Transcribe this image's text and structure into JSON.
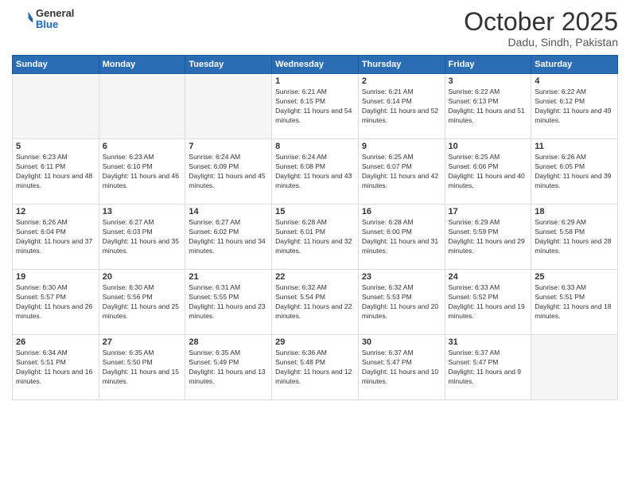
{
  "header": {
    "logo": {
      "general": "General",
      "blue": "Blue"
    },
    "title": "October 2025",
    "subtitle": "Dadu, Sindh, Pakistan"
  },
  "calendar": {
    "weekdays": [
      "Sunday",
      "Monday",
      "Tuesday",
      "Wednesday",
      "Thursday",
      "Friday",
      "Saturday"
    ],
    "weeks": [
      [
        {
          "day": "",
          "sunrise": "",
          "sunset": "",
          "daylight": "",
          "empty": true
        },
        {
          "day": "",
          "sunrise": "",
          "sunset": "",
          "daylight": "",
          "empty": true
        },
        {
          "day": "",
          "sunrise": "",
          "sunset": "",
          "daylight": "",
          "empty": true
        },
        {
          "day": "1",
          "sunrise": "Sunrise: 6:21 AM",
          "sunset": "Sunset: 6:15 PM",
          "daylight": "Daylight: 11 hours and 54 minutes."
        },
        {
          "day": "2",
          "sunrise": "Sunrise: 6:21 AM",
          "sunset": "Sunset: 6:14 PM",
          "daylight": "Daylight: 11 hours and 52 minutes."
        },
        {
          "day": "3",
          "sunrise": "Sunrise: 6:22 AM",
          "sunset": "Sunset: 6:13 PM",
          "daylight": "Daylight: 11 hours and 51 minutes."
        },
        {
          "day": "4",
          "sunrise": "Sunrise: 6:22 AM",
          "sunset": "Sunset: 6:12 PM",
          "daylight": "Daylight: 11 hours and 49 minutes."
        }
      ],
      [
        {
          "day": "5",
          "sunrise": "Sunrise: 6:23 AM",
          "sunset": "Sunset: 6:11 PM",
          "daylight": "Daylight: 11 hours and 48 minutes."
        },
        {
          "day": "6",
          "sunrise": "Sunrise: 6:23 AM",
          "sunset": "Sunset: 6:10 PM",
          "daylight": "Daylight: 11 hours and 46 minutes."
        },
        {
          "day": "7",
          "sunrise": "Sunrise: 6:24 AM",
          "sunset": "Sunset: 6:09 PM",
          "daylight": "Daylight: 11 hours and 45 minutes."
        },
        {
          "day": "8",
          "sunrise": "Sunrise: 6:24 AM",
          "sunset": "Sunset: 6:08 PM",
          "daylight": "Daylight: 11 hours and 43 minutes."
        },
        {
          "day": "9",
          "sunrise": "Sunrise: 6:25 AM",
          "sunset": "Sunset: 6:07 PM",
          "daylight": "Daylight: 11 hours and 42 minutes."
        },
        {
          "day": "10",
          "sunrise": "Sunrise: 6:25 AM",
          "sunset": "Sunset: 6:06 PM",
          "daylight": "Daylight: 11 hours and 40 minutes."
        },
        {
          "day": "11",
          "sunrise": "Sunrise: 6:26 AM",
          "sunset": "Sunset: 6:05 PM",
          "daylight": "Daylight: 11 hours and 39 minutes."
        }
      ],
      [
        {
          "day": "12",
          "sunrise": "Sunrise: 6:26 AM",
          "sunset": "Sunset: 6:04 PM",
          "daylight": "Daylight: 11 hours and 37 minutes."
        },
        {
          "day": "13",
          "sunrise": "Sunrise: 6:27 AM",
          "sunset": "Sunset: 6:03 PM",
          "daylight": "Daylight: 11 hours and 35 minutes."
        },
        {
          "day": "14",
          "sunrise": "Sunrise: 6:27 AM",
          "sunset": "Sunset: 6:02 PM",
          "daylight": "Daylight: 11 hours and 34 minutes."
        },
        {
          "day": "15",
          "sunrise": "Sunrise: 6:28 AM",
          "sunset": "Sunset: 6:01 PM",
          "daylight": "Daylight: 11 hours and 32 minutes."
        },
        {
          "day": "16",
          "sunrise": "Sunrise: 6:28 AM",
          "sunset": "Sunset: 6:00 PM",
          "daylight": "Daylight: 11 hours and 31 minutes."
        },
        {
          "day": "17",
          "sunrise": "Sunrise: 6:29 AM",
          "sunset": "Sunset: 5:59 PM",
          "daylight": "Daylight: 11 hours and 29 minutes."
        },
        {
          "day": "18",
          "sunrise": "Sunrise: 6:29 AM",
          "sunset": "Sunset: 5:58 PM",
          "daylight": "Daylight: 11 hours and 28 minutes."
        }
      ],
      [
        {
          "day": "19",
          "sunrise": "Sunrise: 6:30 AM",
          "sunset": "Sunset: 5:57 PM",
          "daylight": "Daylight: 11 hours and 26 minutes."
        },
        {
          "day": "20",
          "sunrise": "Sunrise: 6:30 AM",
          "sunset": "Sunset: 5:56 PM",
          "daylight": "Daylight: 11 hours and 25 minutes."
        },
        {
          "day": "21",
          "sunrise": "Sunrise: 6:31 AM",
          "sunset": "Sunset: 5:55 PM",
          "daylight": "Daylight: 11 hours and 23 minutes."
        },
        {
          "day": "22",
          "sunrise": "Sunrise: 6:32 AM",
          "sunset": "Sunset: 5:54 PM",
          "daylight": "Daylight: 11 hours and 22 minutes."
        },
        {
          "day": "23",
          "sunrise": "Sunrise: 6:32 AM",
          "sunset": "Sunset: 5:53 PM",
          "daylight": "Daylight: 11 hours and 20 minutes."
        },
        {
          "day": "24",
          "sunrise": "Sunrise: 6:33 AM",
          "sunset": "Sunset: 5:52 PM",
          "daylight": "Daylight: 11 hours and 19 minutes."
        },
        {
          "day": "25",
          "sunrise": "Sunrise: 6:33 AM",
          "sunset": "Sunset: 5:51 PM",
          "daylight": "Daylight: 11 hours and 18 minutes."
        }
      ],
      [
        {
          "day": "26",
          "sunrise": "Sunrise: 6:34 AM",
          "sunset": "Sunset: 5:51 PM",
          "daylight": "Daylight: 11 hours and 16 minutes."
        },
        {
          "day": "27",
          "sunrise": "Sunrise: 6:35 AM",
          "sunset": "Sunset: 5:50 PM",
          "daylight": "Daylight: 11 hours and 15 minutes."
        },
        {
          "day": "28",
          "sunrise": "Sunrise: 6:35 AM",
          "sunset": "Sunset: 5:49 PM",
          "daylight": "Daylight: 11 hours and 13 minutes."
        },
        {
          "day": "29",
          "sunrise": "Sunrise: 6:36 AM",
          "sunset": "Sunset: 5:48 PM",
          "daylight": "Daylight: 11 hours and 12 minutes."
        },
        {
          "day": "30",
          "sunrise": "Sunrise: 6:37 AM",
          "sunset": "Sunset: 5:47 PM",
          "daylight": "Daylight: 11 hours and 10 minutes."
        },
        {
          "day": "31",
          "sunrise": "Sunrise: 6:37 AM",
          "sunset": "Sunset: 5:47 PM",
          "daylight": "Daylight: 11 hours and 9 minutes."
        },
        {
          "day": "",
          "sunrise": "",
          "sunset": "",
          "daylight": "",
          "empty": true
        }
      ]
    ]
  }
}
